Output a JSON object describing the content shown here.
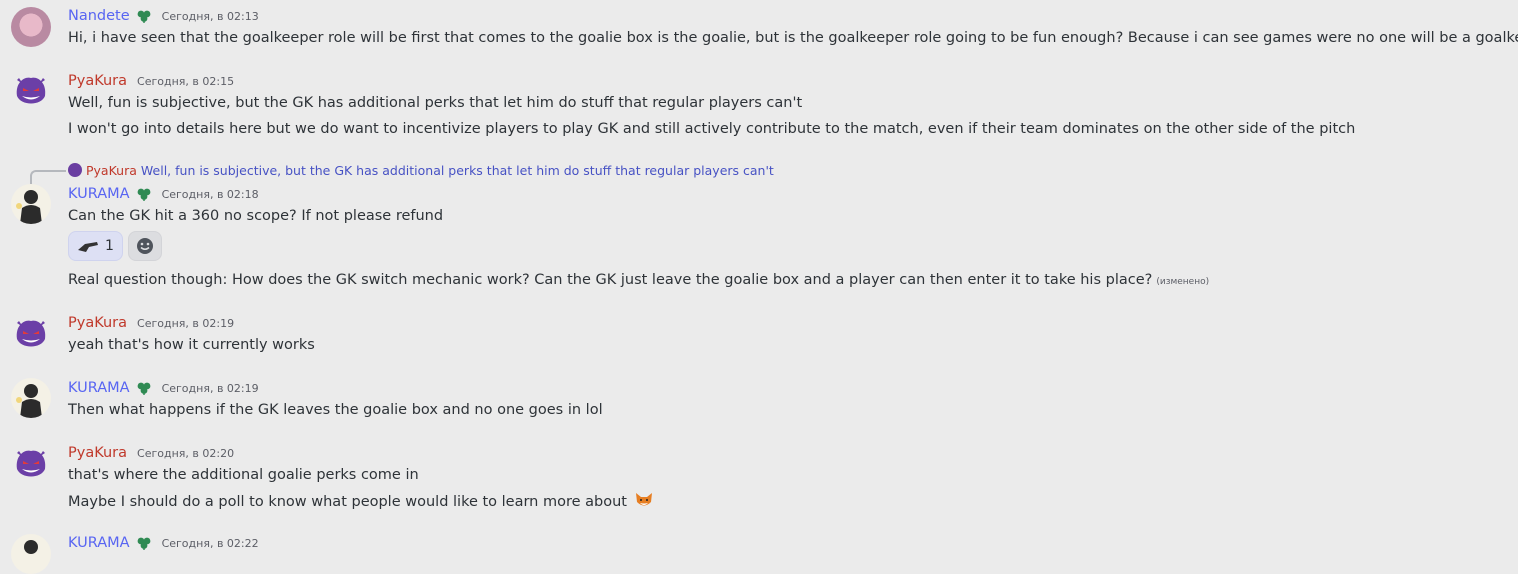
{
  "messages": [
    {
      "author": "Nandete",
      "time": "Сегодня, в 02:13",
      "lines": [
        "Hi, i have seen that the goalkeeper role will be first that comes to the goalie box is the goalie, but is the goalkeeper role going to be fun enough? Because i can see games were no one will be a goalkeeper."
      ]
    },
    {
      "author": "PyaKura",
      "time": "Сегодня, в 02:15",
      "lines": [
        "Well, fun is subjective, but the GK has additional perks that let him do stuff that regular players can't",
        "I won't go into details here but we do want to incentivize players to play GK and still actively contribute to the match, even if their team dominates on the other side of the pitch"
      ]
    },
    {
      "author": "KURAMA",
      "time": "Сегодня, в 02:18",
      "reply": {
        "author": "PyaKura",
        "text": "Well, fun is subjective, but the GK has additional perks that let him do stuff that regular players can't"
      },
      "lines": [
        "Can the GK hit a 360 no scope? If not please refund",
        "Real question though: How does the GK switch mechanic work? Can the GK just leave the goalie box and a player can then enter it to take his place?"
      ],
      "edited": "(изменено)",
      "reaction_count": "1"
    },
    {
      "author": "PyaKura",
      "time": "Сегодня, в 02:19",
      "lines": [
        "yeah that's how it currently works"
      ]
    },
    {
      "author": "KURAMA",
      "time": "Сегодня, в 02:19",
      "lines": [
        "Then what happens if the GK leaves the goalie box and no one goes in lol"
      ]
    },
    {
      "author": "PyaKura",
      "time": "Сегодня, в 02:20",
      "lines": [
        "that's where the additional goalie perks come in",
        "Maybe I should do a poll to know what people would like to learn more about"
      ]
    },
    {
      "author": "KURAMA",
      "time": "Сегодня, в 02:22",
      "lines": []
    }
  ],
  "colors": {
    "pyakura": "#c0392b",
    "kurama": "#5865f2",
    "nandete": "#5865f2",
    "background": "#ebebeb"
  }
}
